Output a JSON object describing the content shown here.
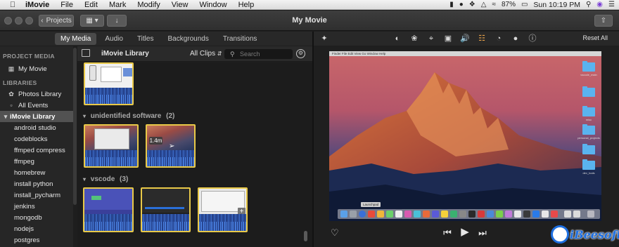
{
  "menubar": {
    "app_name": "iMovie",
    "items": [
      "File",
      "Edit",
      "Mark",
      "Modify",
      "View",
      "Window",
      "Help"
    ],
    "battery": "87%",
    "clock": "Sun 10:19 PM"
  },
  "toolbar": {
    "projects_label": "Projects",
    "title": "My Movie"
  },
  "tabs": [
    {
      "label": "My Media",
      "active": true
    },
    {
      "label": "Audio",
      "active": false
    },
    {
      "label": "Titles",
      "active": false
    },
    {
      "label": "Backgrounds",
      "active": false
    },
    {
      "label": "Transitions",
      "active": false
    }
  ],
  "viewer_toolbar": {
    "reset_label": "Reset All",
    "icons": [
      "magic-wand-icon",
      "color-balance-icon",
      "color-palette-icon",
      "crop-icon",
      "stabilization-icon",
      "volume-icon",
      "equalizer-icon",
      "speed-icon",
      "noise-reduction-icon",
      "info-icon"
    ]
  },
  "sidebar": {
    "project_media_header": "PROJECT MEDIA",
    "project_item": "My Movie",
    "libraries_header": "LIBRARIES",
    "photos_library": "Photos Library",
    "all_events": "All Events",
    "library_name": "iMovie Library",
    "events": [
      "android studio",
      "codeblocks",
      "ffmped compress",
      "ffmpeg",
      "homebrew",
      "install python",
      "install_pycharm",
      "jenkins",
      "mongodb",
      "nodejs",
      "postgres"
    ]
  },
  "library_header": {
    "title": "iMovie Library",
    "filter": "All Clips",
    "search_placeholder": "Search"
  },
  "browser": {
    "groups": [
      {
        "name": "unidentified software",
        "count": "(2)"
      },
      {
        "name": "vscode",
        "count": "(3)"
      }
    ],
    "hover_duration": "1.4m"
  },
  "viewer_screen": {
    "menubar_text": "Finder   File   Edit   View   Go   Window   Help",
    "tooltip": "Launchpad",
    "folder_labels": [
      "vscode_main",
      "",
      "misc",
      "personal_projects",
      "",
      "dev_tools"
    ]
  },
  "watermark": {
    "brand": "iBeesoft"
  },
  "colors": {
    "accent_yellow": "#e9c948",
    "selection_gray": "#525252",
    "folder_blue": "#5ab3ef"
  }
}
